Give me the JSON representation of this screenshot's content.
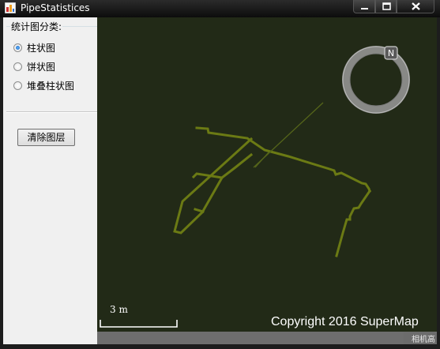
{
  "window": {
    "title": "PipeStatistices",
    "icons": {
      "app": "app-icon",
      "minimize": "minimize-icon",
      "maximize": "maximize-icon",
      "close": "close-icon"
    }
  },
  "panel": {
    "group_title": "统计图分类:",
    "options": [
      {
        "label": "柱状图",
        "checked": true
      },
      {
        "label": "饼状图",
        "checked": false
      },
      {
        "label": "堆叠柱状图",
        "checked": false
      }
    ],
    "clear_button": "清除图层"
  },
  "map": {
    "background": "#222a17",
    "pipe_color": "#6b7a14",
    "scale_label": "3 m",
    "copyright": "Copyright 2016 SuperMap",
    "camera_label": "相机高",
    "compass_label": "N"
  }
}
